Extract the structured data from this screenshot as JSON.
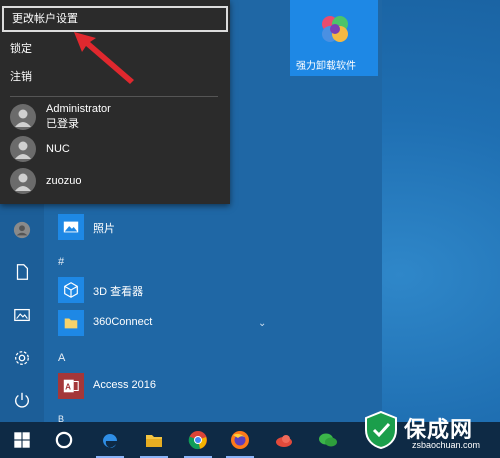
{
  "popup": {
    "change_account_settings": "更改帐户设置",
    "lock": "锁定",
    "sign_out": "注销",
    "users": [
      {
        "name": "Administrator",
        "status": "已登录"
      },
      {
        "name": "NUC"
      },
      {
        "name": "zuozuo"
      }
    ]
  },
  "tile": {
    "label": "强力卸载软件"
  },
  "apps": [
    {
      "label": "照片",
      "icon": "photos-icon"
    },
    {
      "label": "3D 查看器",
      "icon": "3d-viewer-icon"
    },
    {
      "label": "360Connect",
      "icon": "folder-icon"
    },
    {
      "label": "Access 2016",
      "icon": "access-icon"
    }
  ],
  "letters": {
    "hash": "#",
    "a": "A",
    "b": "B"
  },
  "watermark": {
    "brand": "保成网",
    "url": "zsbaochuan.com"
  },
  "colors": {
    "accent": "#1e88e5",
    "popup_bg": "#2b2b2b",
    "arrow": "#e0282e"
  }
}
